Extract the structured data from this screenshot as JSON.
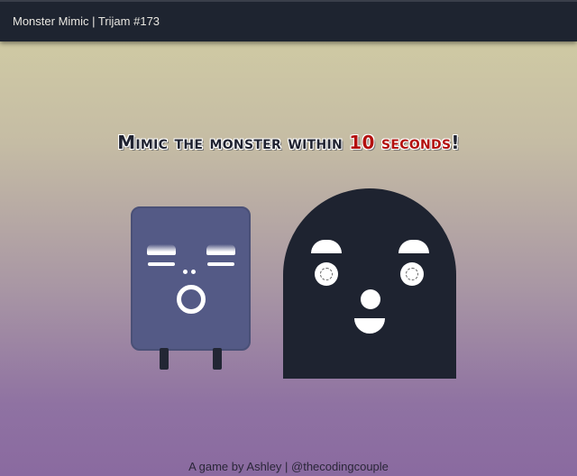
{
  "header": {
    "title": "Monster Mimic | Trijam #173"
  },
  "headline": {
    "prefix": "Mimic the monster within ",
    "accent": "10 seconds",
    "suffix": "!"
  },
  "footer": {
    "credit": "A game by Ashley | @thecodingcouple"
  },
  "colors": {
    "topbar": "#1e2430",
    "small_monster": "#545a86",
    "big_monster": "#1e2330",
    "accent": "#b3100e"
  },
  "monsters": {
    "player": {
      "expression": "surprised"
    },
    "target": {
      "expression": "happy"
    }
  }
}
